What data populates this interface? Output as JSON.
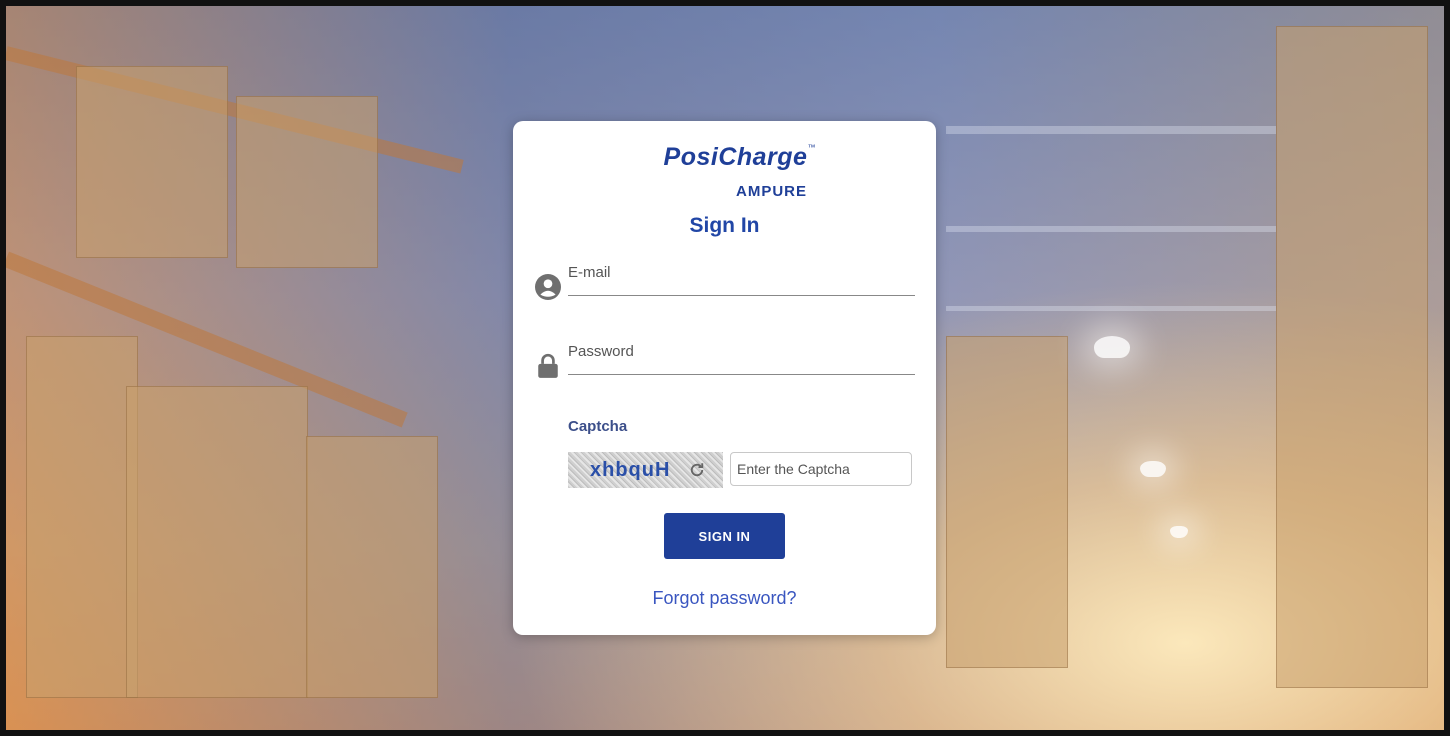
{
  "brand": {
    "logo_main": "PosiCharge",
    "logo_tm": "™",
    "logo_sub": "AMPURE"
  },
  "form": {
    "title": "Sign In",
    "email_label": "E-mail",
    "password_label": "Password",
    "captcha_label": "Captcha",
    "captcha_text": "xhbquH",
    "captcha_placeholder": "Enter the Captcha",
    "signin_label": "SIGN IN",
    "forgot_label": "Forgot password?"
  },
  "icons": {
    "email": "user-icon",
    "password": "lock-icon",
    "refresh": "refresh-icon"
  },
  "colors": {
    "brand": "#1f3f98",
    "link": "#3a56c0",
    "title": "#2146a6"
  }
}
